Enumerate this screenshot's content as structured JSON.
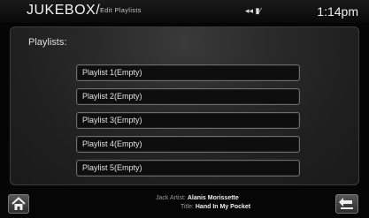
{
  "header": {
    "title": "JUKEBOX/",
    "subtitle": "Edit Playlists",
    "status_icons": "◂◂ ▮∕",
    "clock": "1:14pm"
  },
  "panel": {
    "title": "Playlists:",
    "items": [
      {
        "label": "Playlist 1(Empty)"
      },
      {
        "label": "Playlist 2(Empty)"
      },
      {
        "label": "Playlist 3(Empty)"
      },
      {
        "label": "Playlist 4(Empty)"
      },
      {
        "label": "Playlist 5(Empty)"
      }
    ]
  },
  "now_playing": {
    "source": "Jack",
    "artist_label": "Artist:",
    "artist": "Alanis Morissette",
    "title_label": "Title:",
    "title": "Hand In My Pocket"
  },
  "buttons": {
    "home_icon": "home-icon",
    "back_icon": "back-arrow-icon"
  }
}
